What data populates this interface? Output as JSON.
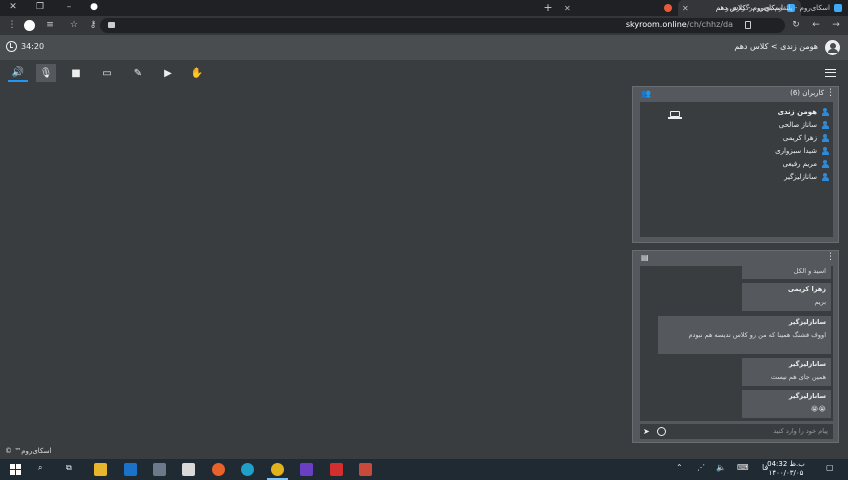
{
  "browser": {
    "tabs": [
      {
        "title": "اسکای‌روم - پلتفرم بومی برگزاری و...",
        "active": false
      },
      {
        "title": "اسکای‌روم - کلاس دهم",
        "active": true
      },
      {
        "title": "",
        "active": false
      }
    ],
    "new_tab": "+",
    "url_host": "skyroom.online",
    "url_path": "/ch/chhz/da"
  },
  "header": {
    "timer": "34:20",
    "breadcrumb": "هومن زندی > کلاس دهم"
  },
  "users": {
    "title": "کاربران (6)",
    "list": [
      {
        "name": "هومن زندی",
        "bold": true
      },
      {
        "name": "ساناز صالحی",
        "bold": false
      },
      {
        "name": "زهرا کریمی",
        "bold": false
      },
      {
        "name": "شیدا سبزواری",
        "bold": false
      },
      {
        "name": "مریم رفیعی",
        "bold": false
      },
      {
        "name": "سانازلیزگیر",
        "bold": false
      }
    ]
  },
  "chat": {
    "messages": [
      {
        "sender": "",
        "text": "اسید و الکل"
      },
      {
        "sender": "زهرا کریمی",
        "text": "بریم"
      },
      {
        "sender": "سانازلیزگیر",
        "text": "اووف قشنگ همینا که من رو کلاس ندیسه هم نبودم"
      },
      {
        "sender": "سانازلیزگیر",
        "text": "همین جای هم نیست"
      },
      {
        "sender": "سانازلیزگیر",
        "text": "😭😭"
      }
    ],
    "placeholder": "پیام خود را وارد کنید"
  },
  "footer": {
    "copyright": "اسکای‌روم™ ©"
  },
  "taskbar": {
    "time": "04:32 ب.ظ",
    "date": "۱۴۰۰/۰۳/۰۵",
    "lang": "فا"
  },
  "colors": {
    "accent": "#2196f3",
    "user_icon": "#2e8bd9",
    "background": "#3a3d40",
    "panel": "#55585c"
  }
}
